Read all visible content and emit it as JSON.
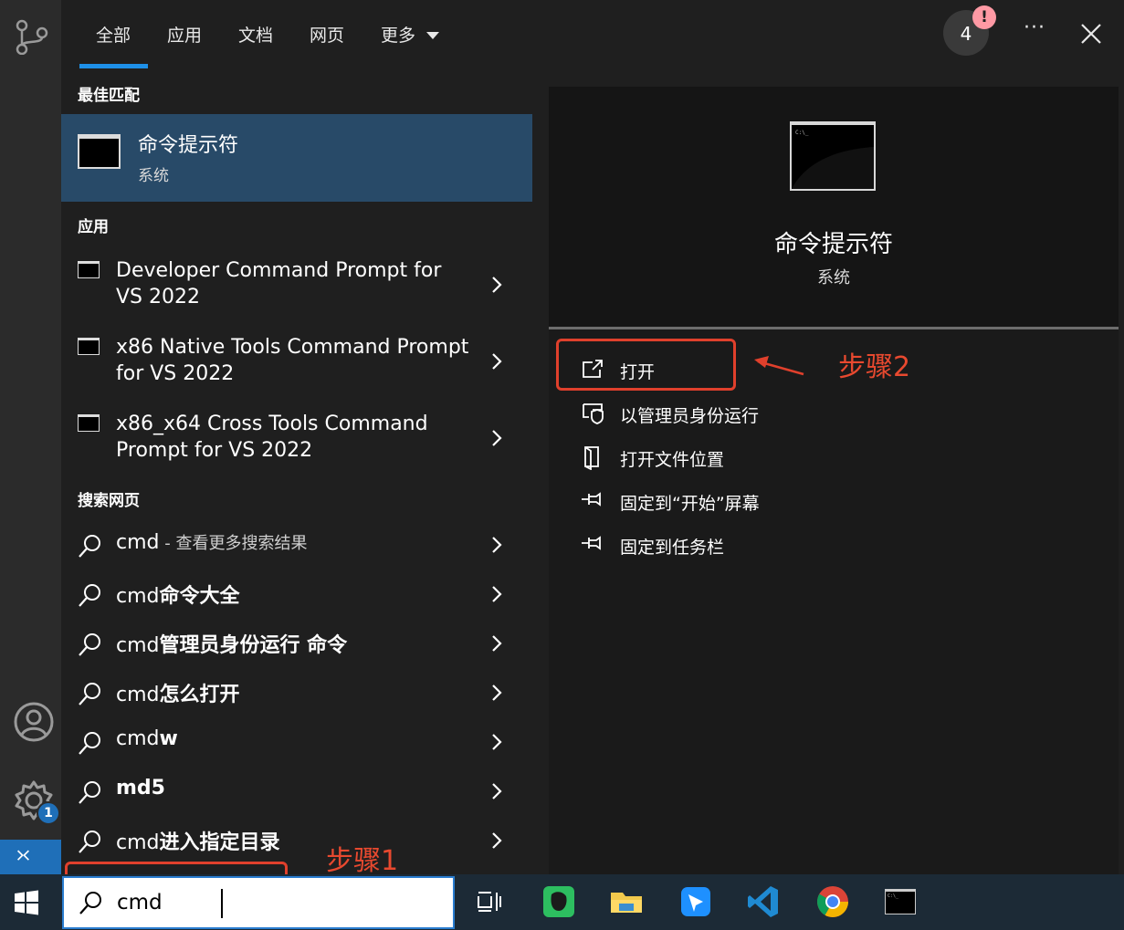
{
  "header": {
    "tabs": [
      {
        "label": "全部",
        "active": true
      },
      {
        "label": "应用"
      },
      {
        "label": "文档"
      },
      {
        "label": "网页"
      },
      {
        "label": "更多"
      }
    ],
    "badge_count": "4",
    "badge_alert": "!",
    "more_label": "···"
  },
  "best_match": {
    "section_title": "最佳匹配",
    "title": "命令提示符",
    "subtitle": "系统"
  },
  "apps": {
    "section_title": "应用",
    "items": [
      {
        "label": "Developer Command Prompt for VS 2022"
      },
      {
        "label": "x86 Native Tools Command Prompt for VS 2022"
      },
      {
        "label": "x86_x64 Cross Tools Command Prompt for VS 2022"
      }
    ]
  },
  "web": {
    "section_title": "搜索网页",
    "items": [
      {
        "prefix": "cmd",
        "bold": "",
        "hint": " - 查看更多搜索结果"
      },
      {
        "prefix": "cmd",
        "bold": "命令大全",
        "hint": ""
      },
      {
        "prefix": "cmd",
        "bold": "管理员身份运行 命令",
        "hint": ""
      },
      {
        "prefix": "cmd",
        "bold": "怎么打开",
        "hint": ""
      },
      {
        "prefix": "cmd",
        "bold": "w",
        "hint": ""
      },
      {
        "prefix": "",
        "bold": "md5",
        "hint": ""
      },
      {
        "prefix": "cmd",
        "bold": "进入指定目录",
        "hint": ""
      }
    ]
  },
  "preview": {
    "title": "命令提示符",
    "subtitle": "系统",
    "actions": [
      {
        "label": "打开",
        "icon": "open-external-icon"
      },
      {
        "label": "以管理员身份运行",
        "icon": "shield-icon"
      },
      {
        "label": "打开文件位置",
        "icon": "file-location-icon"
      },
      {
        "label": "固定到“开始”屏幕",
        "icon": "pin-icon"
      },
      {
        "label": "固定到任务栏",
        "icon": "pin-icon"
      }
    ]
  },
  "annotations": {
    "step1": "步骤1",
    "step2": "步骤2"
  },
  "sidebar": {
    "settings_badge": "1"
  },
  "taskbar": {
    "search_value": "cmd",
    "apps": [
      "task-view-icon",
      "evernote-icon",
      "file-explorer-icon",
      "feishu-icon",
      "vscode-icon",
      "chrome-icon",
      "cmd-icon"
    ]
  },
  "colors": {
    "accent": "#1e90e8",
    "selection": "#284a68",
    "annotation_red": "#e0402c"
  }
}
